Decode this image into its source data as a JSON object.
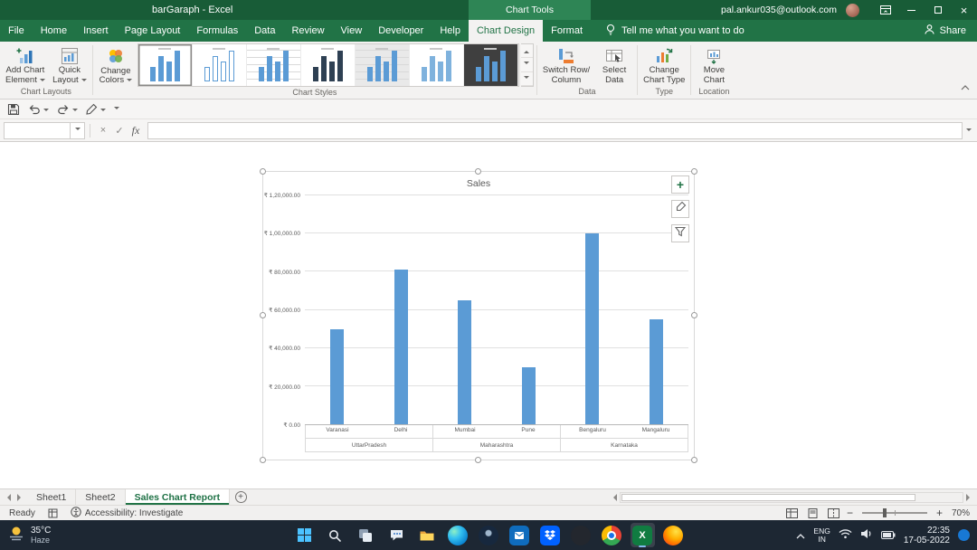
{
  "titlebar": {
    "title": "barGaraph - Excel",
    "context_label": "Chart Tools",
    "account_email": "pal.ankur035@outlook.com"
  },
  "ribbon": {
    "tabs": [
      {
        "label": "File",
        "type": "file"
      },
      {
        "label": "Home"
      },
      {
        "label": "Insert"
      },
      {
        "label": "Page Layout"
      },
      {
        "label": "Formulas"
      },
      {
        "label": "Data"
      },
      {
        "label": "Review"
      },
      {
        "label": "View"
      },
      {
        "label": "Developer"
      },
      {
        "label": "Help"
      },
      {
        "label": "Chart Design",
        "active": true
      },
      {
        "label": "Format"
      }
    ],
    "tell_me": "Tell me what you want to do",
    "share_label": "Share",
    "chart_layouts": {
      "group_label": "Chart Layouts",
      "add_chart_element": {
        "l1": "Add Chart",
        "l2": "Element"
      },
      "quick_layout": {
        "l1": "Quick",
        "l2": "Layout"
      }
    },
    "chart_styles_group": {
      "group_label": "Chart Styles",
      "change_colors": {
        "l1": "Change",
        "l2": "Colors"
      },
      "styles": [
        "Style 1",
        "Style 2",
        "Style 3",
        "Style 4",
        "Style 5",
        "Style 6",
        "Style 7"
      ]
    },
    "data_group": {
      "group_label": "Data",
      "switch_row_column": {
        "l1": "Switch Row/",
        "l2": "Column"
      },
      "select_data": {
        "l1": "Select",
        "l2": "Data"
      }
    },
    "type_group": {
      "group_label": "Type",
      "change_chart_type": {
        "l1": "Change",
        "l2": "Chart Type"
      }
    },
    "location_group": {
      "group_label": "Location",
      "move_chart": {
        "l1": "Move",
        "l2": "Chart"
      }
    }
  },
  "formula_bar": {
    "name_box": "",
    "fx": "fx",
    "value": ""
  },
  "chart_data": {
    "type": "bar",
    "title": "Sales",
    "categories": [
      "Varanasi",
      "Delhi",
      "Mumbai",
      "Pune",
      "Bengaluru",
      "Mangaluru"
    ],
    "values": [
      50000,
      81000,
      65000,
      30000,
      100000,
      55000
    ],
    "groups": [
      {
        "label": "UttarPradesh",
        "span": [
          0,
          1
        ]
      },
      {
        "label": "Maharashtra",
        "span": [
          2,
          3
        ]
      },
      {
        "label": "Karnataka",
        "span": [
          4,
          5
        ]
      }
    ],
    "y_ticks": [
      "₹ 1,20,000.00",
      "₹ 1,00,000.00",
      "₹ 80,000.00",
      "₹ 60,000.00",
      "₹ 40,000.00",
      "₹ 20,000.00",
      "₹ 0.00"
    ],
    "ylim": [
      0,
      120000
    ],
    "bar_color": "#5b9bd5",
    "grid": true,
    "legend": "none"
  },
  "sheet_bar": {
    "tabs": [
      {
        "label": "Sheet1"
      },
      {
        "label": "Sheet2"
      },
      {
        "label": "Sales Chart Report",
        "active": true
      }
    ]
  },
  "status_bar": {
    "ready": "Ready",
    "accessibility": "Accessibility: Investigate",
    "zoom": "70%"
  },
  "taskbar": {
    "weather": {
      "temp": "35°C",
      "condition": "Haze"
    },
    "icons": [
      "start",
      "search",
      "task-view",
      "chat",
      "file-explorer",
      "edge",
      "app-1",
      "outlook",
      "dropbox",
      "app-2",
      "chrome",
      "excel",
      "firefox"
    ],
    "active_icon": "excel",
    "tray": {
      "lang_line1": "ENG",
      "lang_line2": "IN",
      "time": "22:35",
      "date": "17-05-2022"
    }
  }
}
